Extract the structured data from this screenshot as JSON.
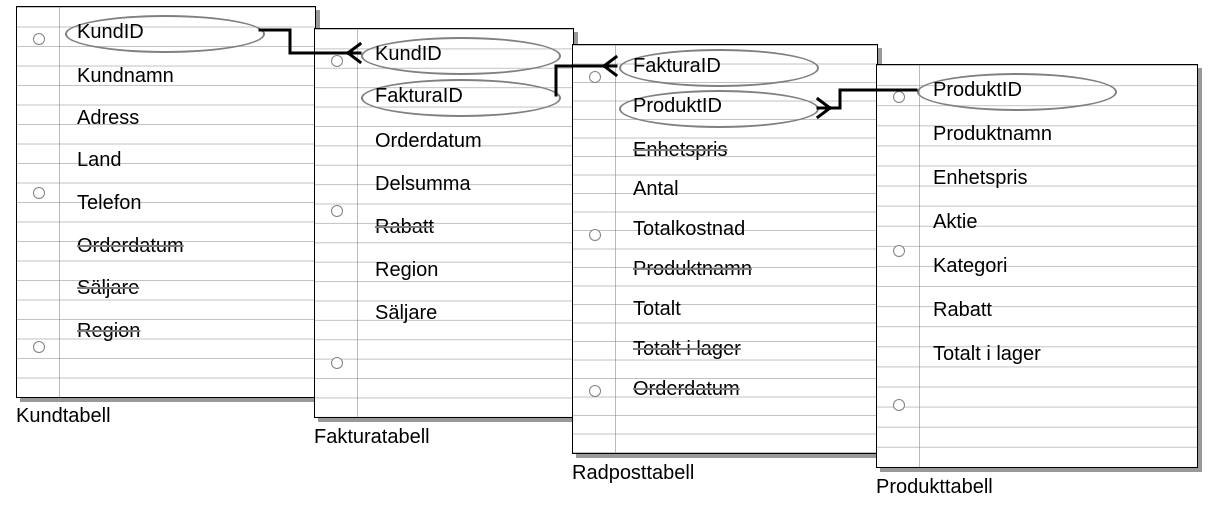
{
  "tables": {
    "kund": {
      "caption": "Kundtabell",
      "fields": {
        "f0": "KundID",
        "f1": "Kundnamn",
        "f2": "Adress",
        "f3": "Land",
        "f4": "Telefon",
        "f5": "Orderdatum",
        "f6": "Säljare",
        "f7": "Region"
      }
    },
    "faktura": {
      "caption": "Fakturatabell",
      "fields": {
        "f0": "KundID",
        "f1": "FakturaID",
        "f2": "Orderdatum",
        "f3": "Delsumma",
        "f4": "Rabatt",
        "f5": "Region",
        "f6": "Säljare"
      }
    },
    "radpost": {
      "caption": "Radposttabell",
      "fields": {
        "f0": "FakturaID",
        "f1": "ProduktID",
        "f2": "Enhetspris",
        "f3": "Antal",
        "f4": "Totalkostnad",
        "f5": "Produktnamn",
        "f6": "Totalt",
        "f7": "Totalt i lager",
        "f8": "Orderdatum"
      }
    },
    "produkt": {
      "caption": "Produkttabell",
      "fields": {
        "f0": "ProduktID",
        "f1": "Produktnamn",
        "f2": "Enhetspris",
        "f3": "Aktie",
        "f4": "Kategori",
        "f5": "Rabatt",
        "f6": "Totalt i lager"
      }
    }
  },
  "chart_data": {
    "type": "diagram",
    "title": "",
    "entities": [
      {
        "name": "Kundtabell",
        "keys": [
          "KundID"
        ],
        "fields": [
          "KundID",
          "Kundnamn",
          "Adress",
          "Land",
          "Telefon",
          "Orderdatum",
          "Säljare",
          "Region"
        ],
        "removed_fields": [
          "Orderdatum",
          "Säljare",
          "Region"
        ]
      },
      {
        "name": "Fakturatabell",
        "keys": [
          "KundID",
          "FakturaID"
        ],
        "fields": [
          "KundID",
          "FakturaID",
          "Orderdatum",
          "Delsumma",
          "Rabatt",
          "Region",
          "Säljare"
        ],
        "removed_fields": [
          "Rabatt"
        ]
      },
      {
        "name": "Radposttabell",
        "keys": [
          "FakturaID",
          "ProduktID"
        ],
        "fields": [
          "FakturaID",
          "ProduktID",
          "Enhetspris",
          "Antal",
          "Totalkostnad",
          "Produktnamn",
          "Totalt",
          "Totalt i lager",
          "Orderdatum"
        ],
        "removed_fields": [
          "Enhetspris",
          "Produktnamn",
          "Totalt i lager",
          "Orderdatum"
        ]
      },
      {
        "name": "Produkttabell",
        "keys": [
          "ProduktID"
        ],
        "fields": [
          "ProduktID",
          "Produktnamn",
          "Enhetspris",
          "Aktie",
          "Kategori",
          "Rabatt",
          "Totalt i lager"
        ],
        "removed_fields": []
      }
    ],
    "relationships": [
      {
        "from": "Kundtabell.KundID",
        "to": "Fakturatabell.KundID",
        "type": "one-to-many"
      },
      {
        "from": "Fakturatabell.FakturaID",
        "to": "Radposttabell.FakturaID",
        "type": "one-to-many"
      },
      {
        "from": "Produkttabell.ProduktID",
        "to": "Radposttabell.ProduktID",
        "type": "one-to-many"
      }
    ]
  }
}
